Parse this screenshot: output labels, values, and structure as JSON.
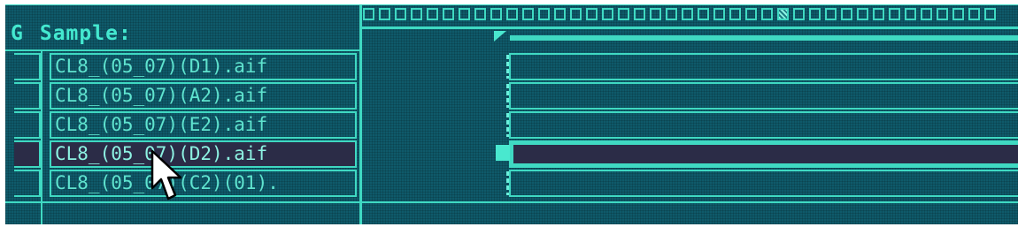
{
  "header": {
    "group_letter": "G",
    "label": "Sample:"
  },
  "samples": [
    {
      "name": "CL8_(05_07)(D1).aif",
      "selected": false
    },
    {
      "name": "CL8_(05_07)(A2).aif",
      "selected": false
    },
    {
      "name": "CL8_(05_07)(E2).aif",
      "selected": false
    },
    {
      "name": "CL8_(05_07)(D2).aif",
      "selected": true
    },
    {
      "name": "CL8_(05_07)(C2)(01).",
      "selected": false
    }
  ],
  "ruler": {
    "active_tick_index": 26
  },
  "colors": {
    "background": "#0f5a6a",
    "accent": "#3fd9c2",
    "selected": "#2b2c47",
    "text": "#5fe3ce"
  },
  "icons": {
    "cursor": "arrow-cursor-icon"
  }
}
